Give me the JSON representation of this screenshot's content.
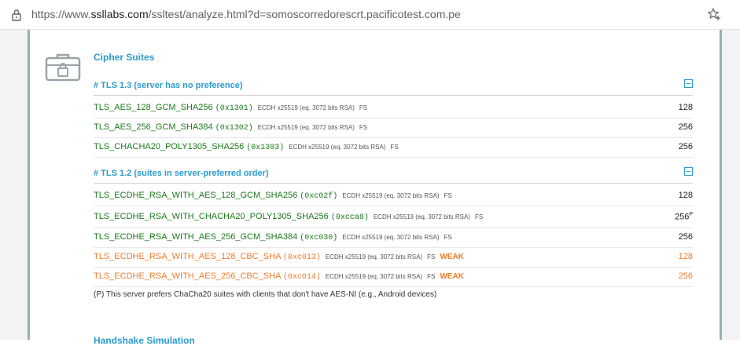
{
  "browser": {
    "url_prefix": "https://www.",
    "url_host": "ssllabs.com",
    "url_path": "/ssltest/analyze.html?d=somoscorredorescrt.pacificotest.com.pe",
    "lock_icon": "lock-icon",
    "star_icon": "star-add-icon"
  },
  "section": {
    "title": "Cipher Suites",
    "icon": "toolbox-lock-icon",
    "next_title": "Handshake Simulation"
  },
  "colors": {
    "accent": "#2a9bd0",
    "strong": "#1b7a1b",
    "weak": "#f07c2a",
    "frame": "#8fb3b6"
  },
  "groups": [
    {
      "title": "# TLS 1.3 (server has no preference)",
      "rows": [
        {
          "name": "TLS_AES_128_GCM_SHA256",
          "code": "(0x1301)",
          "kx": "ECDH x25519 (eq. 3072 bits RSA)",
          "fs": "FS",
          "weak": "",
          "bits": "128",
          "sup": ""
        },
        {
          "name": "TLS_AES_256_GCM_SHA384",
          "code": "(0x1302)",
          "kx": "ECDH x25519 (eq. 3072 bits RSA)",
          "fs": "FS",
          "weak": "",
          "bits": "256",
          "sup": ""
        },
        {
          "name": "TLS_CHACHA20_POLY1305_SHA256",
          "code": "(0x1303)",
          "kx": "ECDH x25519 (eq. 3072 bits RSA)",
          "fs": "FS",
          "weak": "",
          "bits": "256",
          "sup": ""
        }
      ]
    },
    {
      "title": "# TLS 1.2 (suites in server-preferred order)",
      "rows": [
        {
          "name": "TLS_ECDHE_RSA_WITH_AES_128_GCM_SHA256",
          "code": "(0xc02f)",
          "kx": "ECDH x25519 (eq. 3072 bits RSA)",
          "fs": "FS",
          "weak": "",
          "bits": "128",
          "sup": ""
        },
        {
          "name": "TLS_ECDHE_RSA_WITH_CHACHA20_POLY1305_SHA256",
          "code": "(0xcca8)",
          "kx": "ECDH x25519 (eq. 3072 bits RSA)",
          "fs": "FS",
          "weak": "",
          "bits": "256",
          "sup": "P"
        },
        {
          "name": "TLS_ECDHE_RSA_WITH_AES_256_GCM_SHA384",
          "code": "(0xc030)",
          "kx": "ECDH x25519 (eq. 3072 bits RSA)",
          "fs": "FS",
          "weak": "",
          "bits": "256",
          "sup": ""
        },
        {
          "name": "TLS_ECDHE_RSA_WITH_AES_128_CBC_SHA",
          "code": "(0xc013)",
          "kx": "ECDH x25519 (eq. 3072 bits RSA)",
          "fs": "FS",
          "weak": "WEAK",
          "bits": "128",
          "sup": ""
        },
        {
          "name": "TLS_ECDHE_RSA_WITH_AES_256_CBC_SHA",
          "code": "(0xc014)",
          "kx": "ECDH x25519 (eq. 3072 bits RSA)",
          "fs": "FS",
          "weak": "WEAK",
          "bits": "256",
          "sup": ""
        }
      ]
    }
  ],
  "footnote": "(P) This server prefers ChaCha20 suites with clients that don't have AES-NI (e.g., Android devices)"
}
